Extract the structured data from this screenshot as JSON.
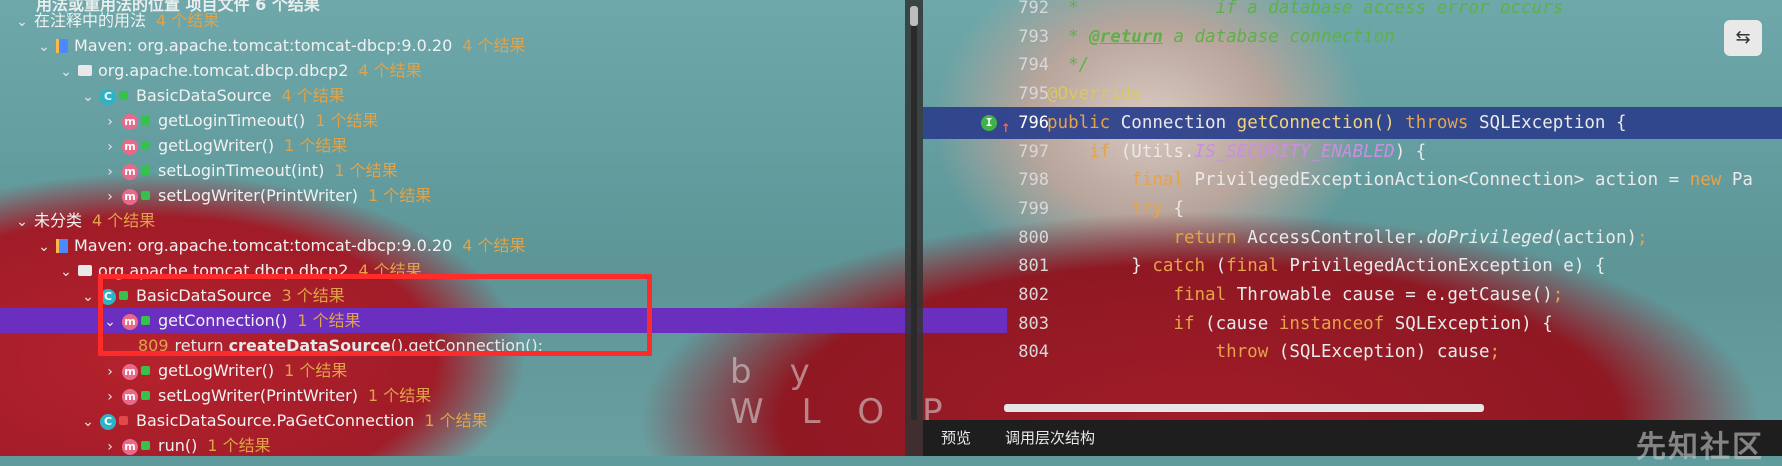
{
  "top_partial": "用法或重用法的位置 项目文件  6 个结果",
  "tree": [
    {
      "indent": 1,
      "expanded": true,
      "kind": "group",
      "label": "在注释中的用法",
      "count": "4 个结果"
    },
    {
      "indent": 2,
      "expanded": true,
      "kind": "maven",
      "label": "Maven: org.apache.tomcat:tomcat-dbcp:9.0.20",
      "count": "4 个结果"
    },
    {
      "indent": 3,
      "expanded": true,
      "kind": "package",
      "label": "org.apache.tomcat.dbcp.dbcp2",
      "count": "4 个结果"
    },
    {
      "indent": 4,
      "expanded": true,
      "kind": "class",
      "label": "BasicDataSource",
      "count": "4 个结果"
    },
    {
      "indent": 5,
      "expanded": false,
      "kind": "method",
      "label": "getLoginTimeout()",
      "count": "1 个结果"
    },
    {
      "indent": 5,
      "expanded": false,
      "kind": "method",
      "label": "getLogWriter()",
      "count": "1 个结果"
    },
    {
      "indent": 5,
      "expanded": false,
      "kind": "method",
      "label": "setLoginTimeout(int)",
      "count": "1 个结果"
    },
    {
      "indent": 5,
      "expanded": false,
      "kind": "method",
      "label": "setLogWriter(PrintWriter)",
      "count": "1 个结果"
    },
    {
      "indent": 1,
      "expanded": true,
      "kind": "group",
      "label": "未分类",
      "count": "4 个结果"
    },
    {
      "indent": 2,
      "expanded": true,
      "kind": "maven",
      "label": "Maven: org.apache.tomcat:tomcat-dbcp:9.0.20",
      "count": "4 个结果"
    },
    {
      "indent": 3,
      "expanded": true,
      "kind": "package",
      "label": "org.apache.tomcat.dbcp.dbcp2",
      "count": "4 个结果"
    },
    {
      "indent": 4,
      "expanded": true,
      "kind": "class",
      "label": "BasicDataSource",
      "count": "3 个结果"
    },
    {
      "indent": 5,
      "expanded": true,
      "kind": "method",
      "label": "getConnection()",
      "count": "1 个结果",
      "selected": true
    },
    {
      "indent": 6,
      "kind": "code",
      "line": "809",
      "pre": "return ",
      "bold": "createDataSource",
      "post": "().getConnection();"
    },
    {
      "indent": 5,
      "expanded": false,
      "kind": "method",
      "label": "getLogWriter()",
      "count": "1 个结果"
    },
    {
      "indent": 5,
      "expanded": false,
      "kind": "method",
      "label": "setLogWriter(PrintWriter)",
      "count": "1 个结果"
    },
    {
      "indent": 4,
      "expanded": true,
      "kind": "class-red",
      "label": "BasicDataSource.PaGetConnection",
      "count": "1 个结果"
    },
    {
      "indent": 5,
      "expanded": false,
      "kind": "method",
      "label": "run()",
      "count": "1 个结果"
    }
  ],
  "bg_watermark": "by WLOP",
  "editor": {
    "lines": [
      {
        "n": "792",
        "html": "<span class='cm'>  *             if a database access error occurs</span>"
      },
      {
        "n": "793",
        "html": "<span class='cm'>  * </span><span class='cmtag'>@return</span><span class='cm'> a database connection</span>"
      },
      {
        "n": "794",
        "html": "<span class='cm'>  */</span>"
      },
      {
        "n": "795",
        "html": "<span class='an'>@Override</span>"
      },
      {
        "n": "796",
        "html": "<span class='kw'>public</span> Connection <span class='fn'>getConnection</span><span class='fn'>()</span> <span class='kw'>throws</span> SQLException {",
        "current": true
      },
      {
        "n": "797",
        "html": "    <span class='kw'>if</span> (Utils.<span class='static'>IS_SECURITY_ENABLED</span>) {"
      },
      {
        "n": "798",
        "html": "        <span class='kw'>final</span> PrivilegedExceptionAction&lt;Connection&gt; action = <span class='kw'>new</span> Pa"
      },
      {
        "n": "799",
        "html": "        <span class='kw'>try</span> {"
      },
      {
        "n": "800",
        "html": "            <span class='kw'>return</span> AccessController.<span class='it'>doPrivileged</span>(action)<span class='kw'>;</span>"
      },
      {
        "n": "801",
        "html": "        } <span class='kw'>catch</span> (<span class='kw'>final</span> PrivilegedActionException e) {"
      },
      {
        "n": "802",
        "html": "            <span class='kw'>final</span> Throwable cause = e.getCause()<span class='kw'>;</span>"
      },
      {
        "n": "803",
        "html": "            <span class='kw'>if</span> (cause <span class='kw'>instanceof</span> SQLException) {"
      },
      {
        "n": "804",
        "html": "                <span class='kw'>throw</span> (SQLException) cause<span class='kw'>;</span>"
      }
    ]
  },
  "bottom_tabs": [
    "预览",
    "调用层次结构"
  ],
  "site_watermark": "先知社区",
  "colors": {
    "selected_row": "#6a2fbf",
    "highlight_box": "#ff2a2a",
    "count": "#e0a34a"
  }
}
